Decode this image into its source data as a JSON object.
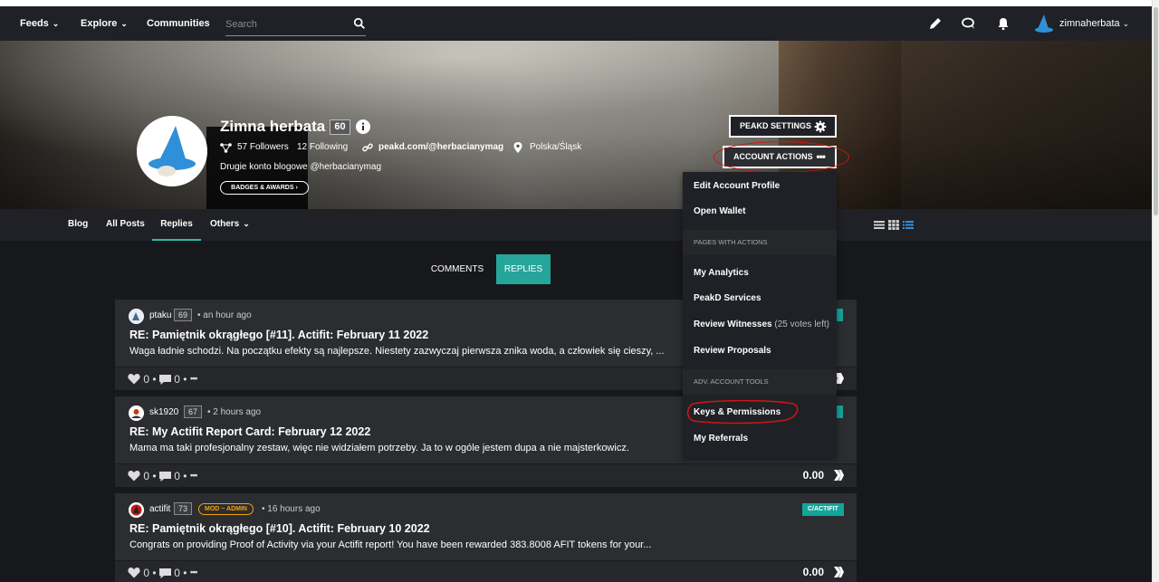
{
  "navbar": {
    "feeds": "Feeds",
    "explore": "Explore",
    "communities": "Communities",
    "search_placeholder": "Search",
    "username": "zimnaherbata"
  },
  "profile": {
    "name": "Zimna herbata",
    "reputation": "60",
    "followers": "57 Followers",
    "following": "12 Following",
    "website": "peakd.com/@herbacianymag",
    "location": "Polska/Śląsk",
    "bio": "Drugie konto blogowe @herbacianymag",
    "badges_label": "BADGES & AWARDS"
  },
  "actions": {
    "peakd_settings": "PEAKD SETTINGS",
    "account_actions": "ACCOUNT ACTIONS"
  },
  "tabs": {
    "blog": "Blog",
    "all_posts": "All Posts",
    "replies": "Replies",
    "others": "Others"
  },
  "subtabs": {
    "comments": "COMMENTS",
    "replies": "REPLIES"
  },
  "dropdown": {
    "edit_profile": "Edit Account Profile",
    "open_wallet": "Open Wallet",
    "header_pages": "PAGES WITH ACTIONS",
    "my_analytics": "My Analytics",
    "peakd_services": "PeakD Services",
    "review_witnesses": "Review Witnesses",
    "witness_votes": "(25 votes left)",
    "review_proposals": "Review Proposals",
    "header_adv": "ADV. ACCOUNT TOOLS",
    "keys_permissions": "Keys & Permissions",
    "my_referrals": "My Referrals"
  },
  "posts": [
    {
      "author": "ptaku",
      "rep": "69",
      "time": "• an hour ago",
      "title": "RE: Pamiętnik okrągłego [#11]. Actifit: February 11 2022",
      "body": "Waga ładnie schodzi. Na początku efekty są najlepsze. Niestety zazwyczaj pierwsza znika woda, a człowiek się cieszy, ...",
      "likes": "0",
      "comments": "0",
      "payout": ""
    },
    {
      "author": "sk1920",
      "rep": "67",
      "time": "• 2 hours ago",
      "title": "RE: My Actifit Report Card: February 12 2022",
      "body": "Mama ma taki profesjonalny zestaw, więc nie widziałem potrzeby. Ja to w ogóle jestem dupa a nie majsterkowicz.",
      "likes": "0",
      "comments": "0",
      "payout": "0.00"
    },
    {
      "author": "actifit",
      "rep": "73",
      "badge": "MOD ~ ADMIN",
      "time": "• 16 hours ago",
      "tag": "C/ACTIFIT",
      "title": "RE: Pamiętnik okrągłego [#10]. Actifit: February 10 2022",
      "body": "Congrats on providing Proof of Activity via your Actifit report! You have been rewarded 383.8008 AFIT tokens for your...",
      "likes": "0",
      "comments": "0",
      "payout": "0.00"
    }
  ],
  "colors": {
    "navbar_bg": "#1f2126",
    "accent_teal": "#26a69a",
    "card_bg": "#2b2d31",
    "annotation_red": "#d01515"
  }
}
